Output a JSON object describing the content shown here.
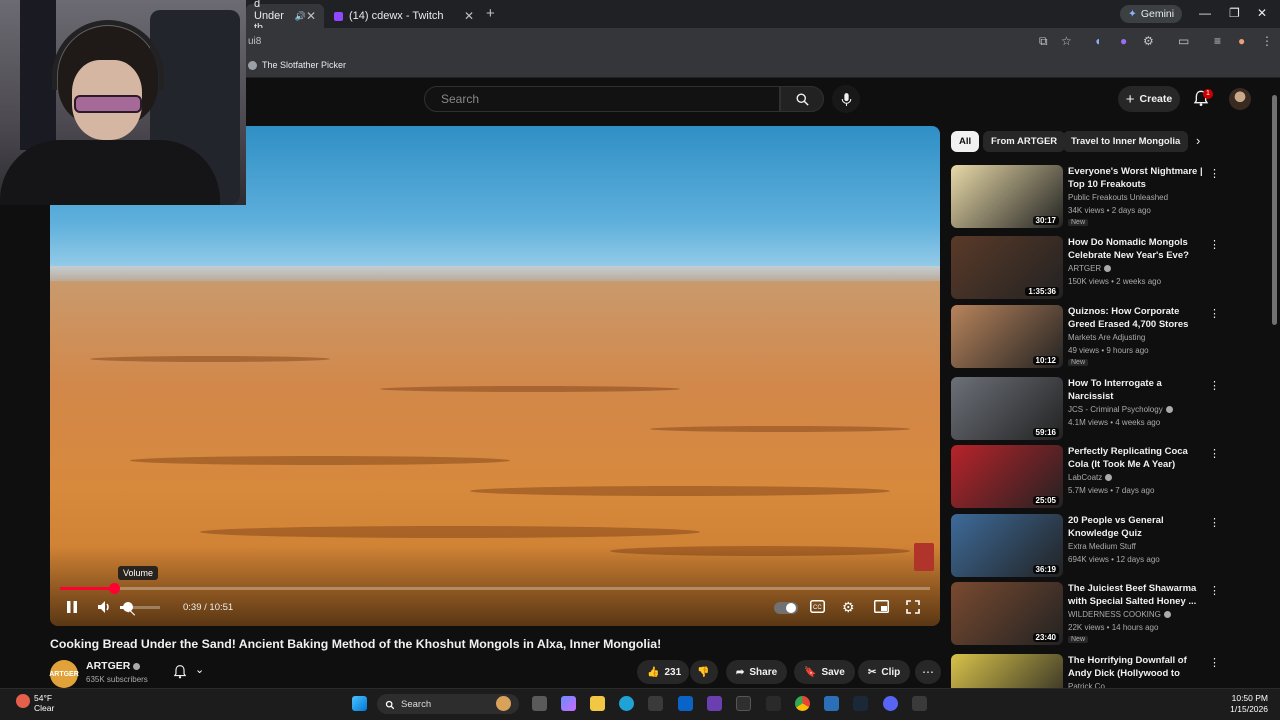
{
  "browser": {
    "tabs": [
      {
        "title": "d Under th",
        "active": true
      },
      {
        "title": "(14) cdewx - Twitch",
        "active": false
      }
    ],
    "url_fragment": "ui8",
    "gemini_label": "Gemini",
    "bookmark": "The Slotfather Picker"
  },
  "header": {
    "search_placeholder": "Search",
    "create_label": "Create",
    "notification_count": "1"
  },
  "player": {
    "time": "0:39 / 10:51",
    "progress_fraction": 0.062,
    "volume_tooltip": "Volume",
    "volume_fraction": 0.2
  },
  "video": {
    "title": "Cooking Bread Under the Sand! Ancient Baking Method of the Khoshut Mongols in Alxa, Inner Mongolia!",
    "channel": "ARTGER",
    "channel_avatar_text": "ARTGER",
    "subscribers": "635K subscribers",
    "likes": "231",
    "share_label": "Share",
    "save_label": "Save",
    "clip_label": "Clip"
  },
  "chips": [
    "All",
    "From ARTGER",
    "Travel to Inner Mongolia"
  ],
  "recommendations": [
    {
      "title": "Everyone's Worst Nightmare | Top 10 Freakouts",
      "channel": "Public Freakouts Unleashed",
      "verified": false,
      "meta": "34K views • 2 days ago",
      "new": "New",
      "duration": "30:17",
      "thumb_color": "#e8d9a8"
    },
    {
      "title": "How Do Nomadic Mongols Celebrate New Year's Eve? Full...",
      "channel": "ARTGER",
      "verified": true,
      "meta": "150K views • 2 weeks ago",
      "new": "",
      "duration": "1:35:36",
      "thumb_color": "#5a3a28"
    },
    {
      "title": "Quiznos: How Corporate Greed Erased 4,700 Stores",
      "channel": "Markets Are Adjusting",
      "verified": false,
      "meta": "49 views • 9 hours ago",
      "new": "New",
      "duration": "10:12",
      "thumb_color": "#b8845c"
    },
    {
      "title": "How To Interrogate a Narcissist",
      "channel": "JCS - Criminal Psychology",
      "verified": true,
      "meta": "4.1M views • 4 weeks ago",
      "new": "",
      "duration": "59:16",
      "thumb_color": "#6c7078"
    },
    {
      "title": "Perfectly Replicating Coca Cola (It Took Me A Year)",
      "channel": "LabCoatz",
      "verified": true,
      "meta": "5.7M views • 7 days ago",
      "new": "",
      "duration": "25:05",
      "thumb_color": "#b8232a"
    },
    {
      "title": "20 People vs General Knowledge Quiz",
      "channel": "Extra Medium Stuff",
      "verified": false,
      "meta": "694K views • 12 days ago",
      "new": "",
      "duration": "36:19",
      "thumb_color": "#3d6b9a"
    },
    {
      "title": "The Juiciest Beef Shawarma with Special Salted Honey ...",
      "channel": "WILDERNESS COOKING",
      "verified": true,
      "meta": "22K views • 14 hours ago",
      "new": "New",
      "duration": "23:40",
      "thumb_color": "#7a4a30"
    },
    {
      "title": "The Horrifying Downfall of Andy Dick (Hollywood to Crack)",
      "channel": "Patrick Co...",
      "verified": false,
      "meta": "",
      "new": "",
      "duration": "",
      "thumb_color": "#d8c24a"
    }
  ],
  "taskbar": {
    "weather_temp": "54°F",
    "weather_desc": "Clear",
    "search_label": "Search",
    "time": "10:50 PM",
    "date": "1/15/2026"
  },
  "colors": {
    "accent": "#ff0033",
    "bg": "#0f0f0f"
  }
}
